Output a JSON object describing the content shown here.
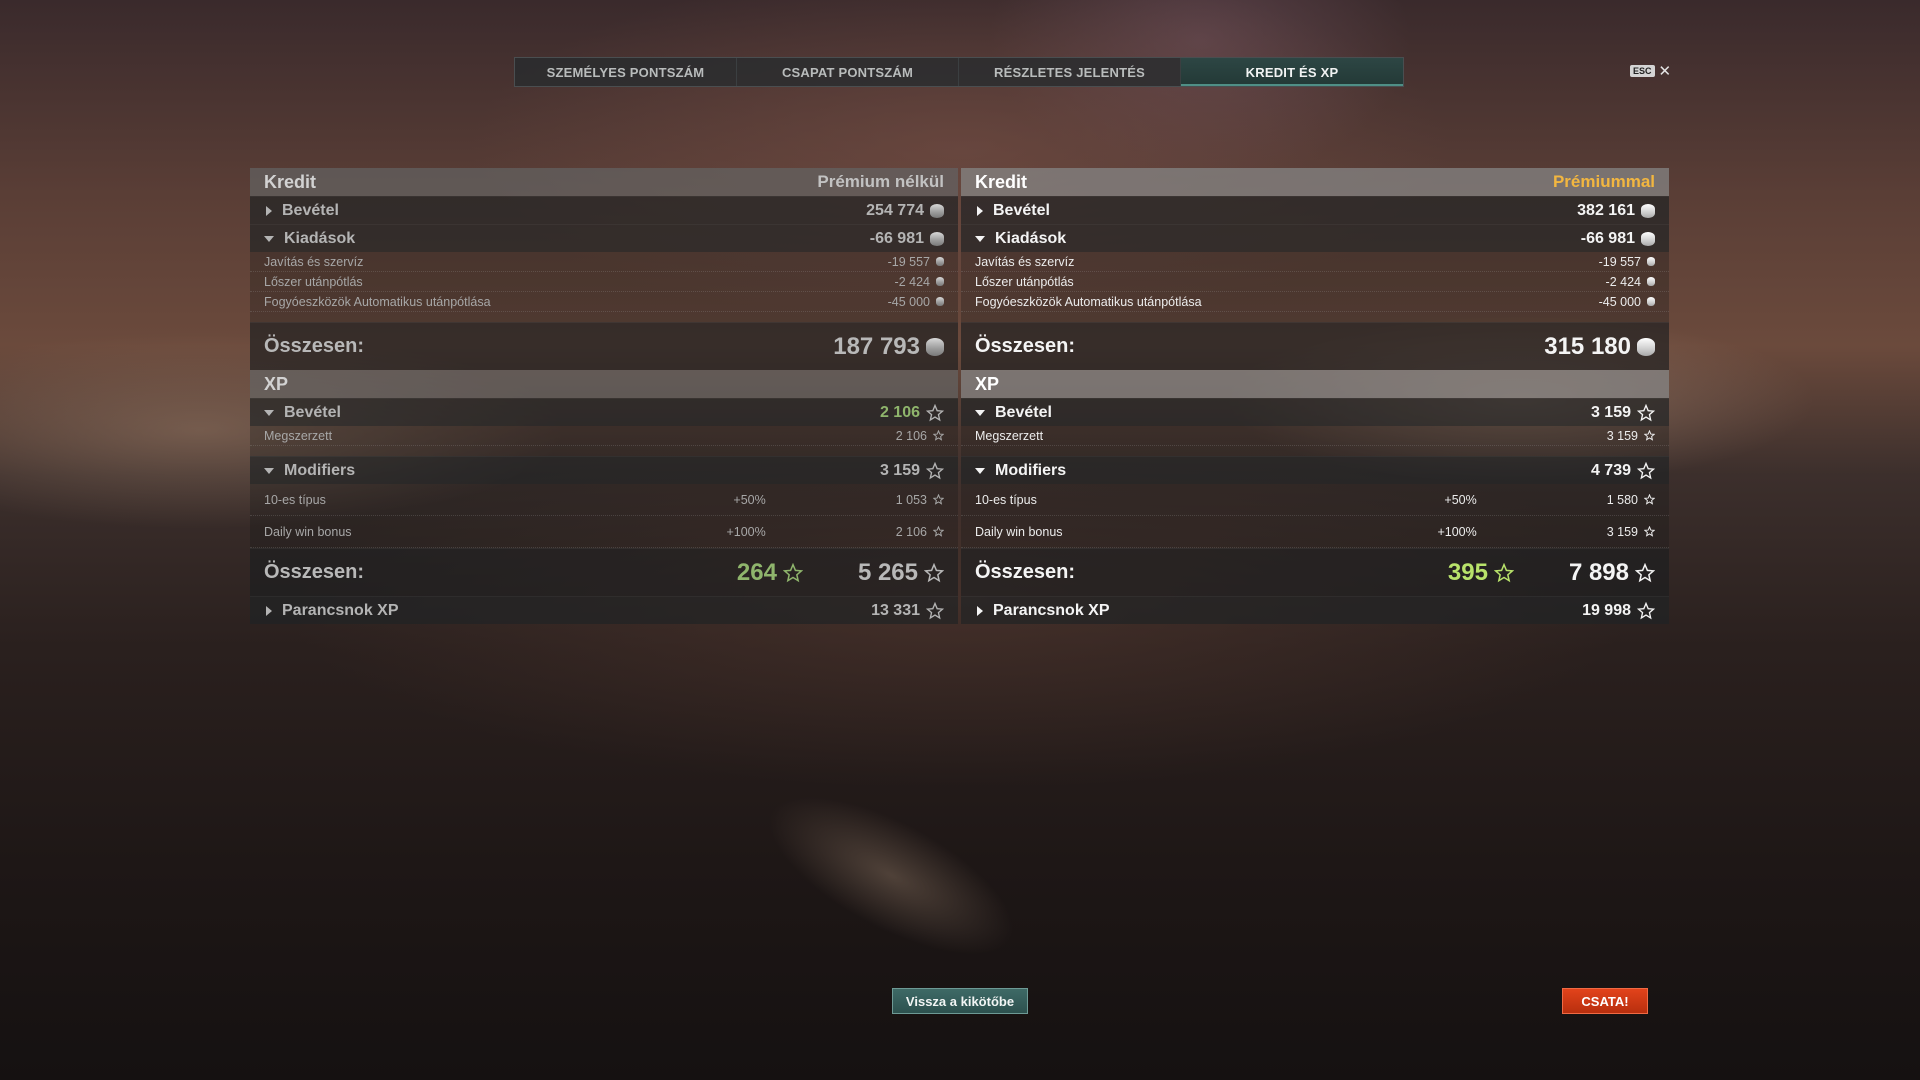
{
  "tabs": [
    {
      "label": "SZEMÉLYES PONTSZÁM"
    },
    {
      "label": "CSAPAT PONTSZÁM"
    },
    {
      "label": "RÉSZLETES JELENTÉS"
    },
    {
      "label": "KREDIT ÉS XP"
    }
  ],
  "esc": {
    "key": "ESC",
    "close": "✕"
  },
  "left": {
    "credit_title": "Kredit",
    "credit_sub": "Prémium nélkül",
    "income_label": "Bevétel",
    "income_value": "254 774",
    "expenses_label": "Kiadások",
    "expenses_value": "-66 981",
    "expense_items": [
      {
        "label": "Javítás és szervíz",
        "value": "-19 557"
      },
      {
        "label": "Lőszer utánpótlás",
        "value": "-2 424"
      },
      {
        "label": "Fogyóeszközök Automatikus utánpótlása",
        "value": "-45 000"
      }
    ],
    "credit_total_label": "Összesen:",
    "credit_total_value": "187 793",
    "xp_title": "XP",
    "xp_income_label": "Bevétel",
    "xp_income_value": "2 106",
    "xp_earned_label": "Megszerzett",
    "xp_earned_value": "2 106",
    "modifiers_label": "Modifiers",
    "modifiers_value": "3 159",
    "modifier_items": [
      {
        "label": "10-es típus",
        "pct": "+50%",
        "value": "1 053"
      },
      {
        "label": "Daily win bonus",
        "pct": "+100%",
        "value": "2 106"
      }
    ],
    "xp_total_label": "Összesen:",
    "xp_total_base": "264",
    "xp_total_value": "5 265",
    "commander_label": "Parancsnok XP",
    "commander_value": "13 331"
  },
  "right": {
    "credit_title": "Kredit",
    "credit_sub": "Prémiummal",
    "income_label": "Bevétel",
    "income_value": "382 161",
    "expenses_label": "Kiadások",
    "expenses_value": "-66 981",
    "expense_items": [
      {
        "label": "Javítás és szervíz",
        "value": "-19 557"
      },
      {
        "label": "Lőszer utánpótlás",
        "value": "-2 424"
      },
      {
        "label": "Fogyóeszközök Automatikus utánpótlása",
        "value": "-45 000"
      }
    ],
    "credit_total_label": "Összesen:",
    "credit_total_value": "315 180",
    "xp_title": "XP",
    "xp_income_label": "Bevétel",
    "xp_income_value": "3 159",
    "xp_earned_label": "Megszerzett",
    "xp_earned_value": "3 159",
    "modifiers_label": "Modifiers",
    "modifiers_value": "4 739",
    "modifier_items": [
      {
        "label": "10-es típus",
        "pct": "+50%",
        "value": "1 580"
      },
      {
        "label": "Daily win bonus",
        "pct": "+100%",
        "value": "3 159"
      }
    ],
    "xp_total_label": "Összesen:",
    "xp_total_base": "395",
    "xp_total_value": "7 898",
    "commander_label": "Parancsnok XP",
    "commander_value": "19 998"
  },
  "buttons": {
    "back": "Vissza a kikötőbe",
    "battle": "CSATA!"
  },
  "colors": {
    "premium_accent": "#f2b640",
    "battle_button": "#d13a14",
    "back_button": "#3a6460",
    "xp_base_green": "#b9e36b"
  }
}
